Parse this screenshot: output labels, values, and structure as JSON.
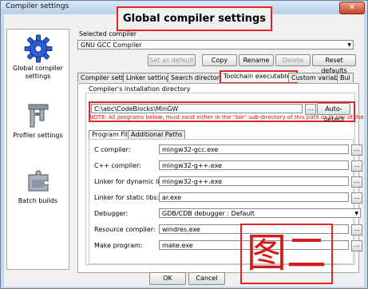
{
  "window": {
    "title": "Compiler settings",
    "close_glyph": "✕"
  },
  "heading": "Global compiler settings",
  "sidebar": {
    "items": [
      {
        "label": "Global compiler settings",
        "icon": "gear-icon"
      },
      {
        "label": "Profiler settings",
        "icon": "caliper-icon"
      },
      {
        "label": "Batch builds",
        "icon": "puzzle-icon"
      }
    ]
  },
  "compiler": {
    "selected_label": "Selected compiler",
    "selected_value": "GNU GCC Compiler",
    "buttons": {
      "set_default": "Set as default",
      "copy": "Copy",
      "rename": "Rename",
      "delete": "Delete",
      "reset": "Reset defaults"
    }
  },
  "tabs": [
    "Compiler settings",
    "Linker settings",
    "Search directories",
    "Toolchain executables",
    "Custom variables",
    "Bui"
  ],
  "toolchain": {
    "install_dir_label": "Compiler's installation directory",
    "install_dir_value": "C:\\abc\\CodeBlocks\\MinGW",
    "browse_label": "...",
    "auto_detect": "Auto-detect",
    "note": "NOTE: All programs below, must exist either in the \"bin\" sub-directory of this path or in any of the",
    "subtabs": [
      "Program Files",
      "Additional Paths"
    ],
    "programs": [
      {
        "label": "C compiler:",
        "value": "mingw32-gcc.exe"
      },
      {
        "label": "C++ compiler:",
        "value": "mingw32-g++.exe"
      },
      {
        "label": "Linker for dynamic libs:",
        "value": "mingw32-g++.exe"
      },
      {
        "label": "Linker for static libs:",
        "value": "ar.exe"
      },
      {
        "label": "Debugger:",
        "value": "GDB/CDB debugger : Default"
      },
      {
        "label": "Resource compiler:",
        "value": "windres.exe"
      },
      {
        "label": "Make program:",
        "value": "make.exe"
      }
    ]
  },
  "annotation": "图二",
  "footer": {
    "ok": "OK",
    "cancel": "Cancel"
  }
}
